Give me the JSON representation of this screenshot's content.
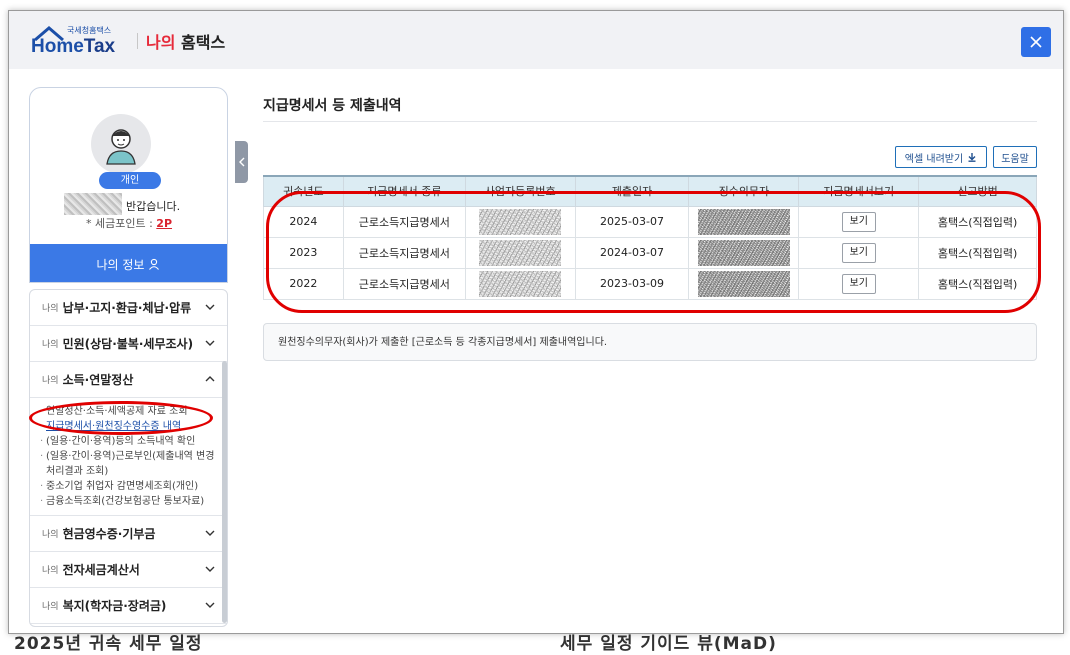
{
  "header": {
    "logo_small": "국세청홈택스",
    "logo_home": "Home",
    "logo_tax": "Tax",
    "title_red": "나의",
    "title_dark": " 홈택스",
    "close_icon": "close-icon",
    "accent": "#2f6fe6"
  },
  "profile": {
    "role": "개인",
    "greeting": "반갑습니다.",
    "points_label": "* 세금포인트 : ",
    "points_value": "2P",
    "my_info": "나의 정보"
  },
  "menu": {
    "items": [
      {
        "prefix": "나의",
        "label": "납부·고지·환급·체납·압류"
      },
      {
        "prefix": "나의",
        "label": "민원(상담·불복·세무조사)"
      },
      {
        "prefix": "나의",
        "label": "소득·연말정산"
      },
      {
        "prefix": "나의",
        "label": "현금영수증·기부금"
      },
      {
        "prefix": "나의",
        "label": "전자세금계산서"
      },
      {
        "prefix": "나의",
        "label": "복지(학자금·장려금)"
      }
    ],
    "sub_items": [
      "연말정산·소득·세액공제 자료 조회",
      "지급명세서·원천징수영수증 내역",
      "(일용·간이·용역)등의 소득내역 확인",
      "(일용·간이·용역)근로부인(제출내역 변경 처리결과 조회)",
      "중소기업 취업자 감면명세조회(개인)",
      "금융소득조회(건강보험공단 통보자료)"
    ]
  },
  "main": {
    "title": "지급명세서 등 제출내역",
    "excel_button": "엑셀 내려받기",
    "help_button": "도움말",
    "table": {
      "headers": [
        "귀속년도",
        "지급명세서 종류",
        "사업자등록번호",
        "제출일자",
        "징수의무자",
        "지급명세서보기",
        "신고방법"
      ],
      "rows": [
        {
          "year": "2024",
          "type": "근로소득지급명세서",
          "date": "2025-03-07",
          "view": "보기",
          "method": "홈택스(직접입력)"
        },
        {
          "year": "2023",
          "type": "근로소득지급명세서",
          "date": "2024-03-07",
          "view": "보기",
          "method": "홈택스(직접입력)"
        },
        {
          "year": "2022",
          "type": "근로소득지급명세서",
          "date": "2023-03-09",
          "view": "보기",
          "method": "홈택스(직접입력)"
        }
      ]
    },
    "notice": "원천징수의무자(회사)가 제출한 [근로소득 등 각종지급명세서] 제출내역입니다."
  },
  "background": {
    "left_fragment": "2025년 귀속 세무 일정",
    "mid_fragment": "세무 일정 기이드 뷰(MaD)"
  }
}
